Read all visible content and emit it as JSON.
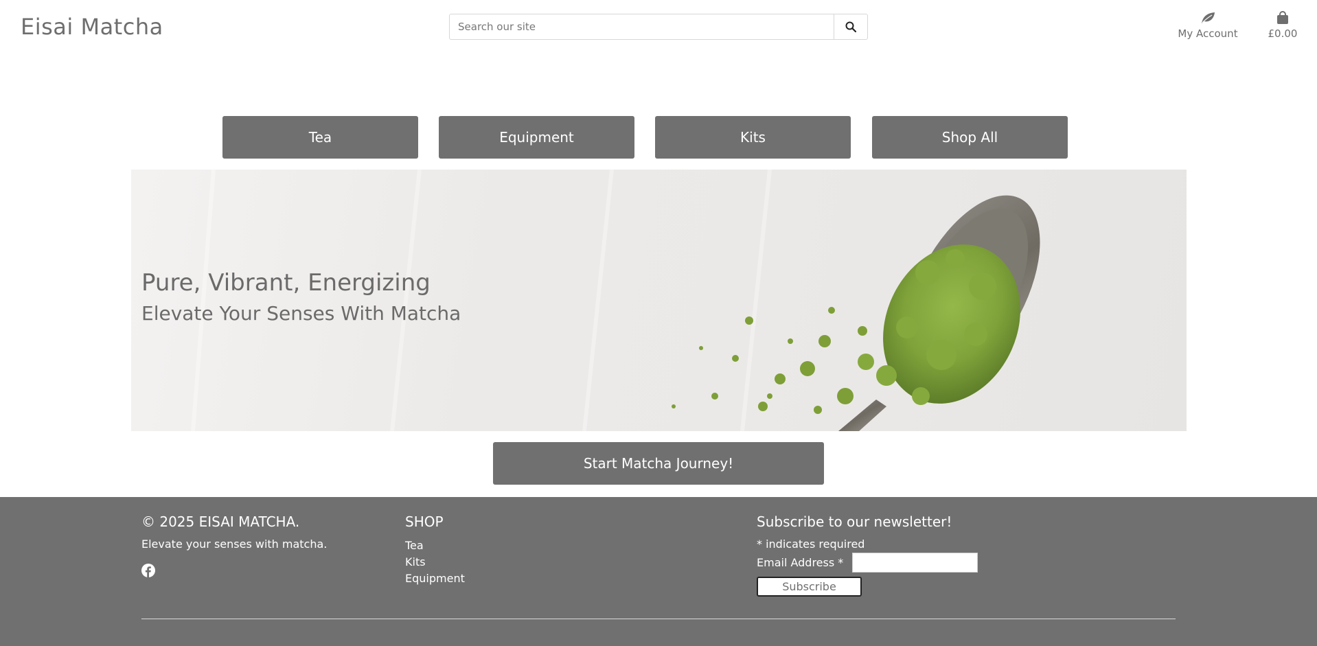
{
  "header": {
    "logo": "Eisai Matcha",
    "search": {
      "placeholder": "Search our site",
      "value": ""
    },
    "account_label": "My Account",
    "cart_total": "£0.00"
  },
  "categories": [
    {
      "label": "Tea"
    },
    {
      "label": "Equipment"
    },
    {
      "label": "Kits"
    },
    {
      "label": "Shop All"
    }
  ],
  "hero": {
    "title": "Pure, Vibrant, Energizing",
    "subtitle": "Elevate Your Senses With Matcha"
  },
  "cta_label": "Start Matcha Journey!",
  "footer": {
    "copyright": "© 2025 EISAI MATCHA.",
    "tagline": "Elevate your senses with matcha.",
    "social_icon": "facebook-icon",
    "shop_heading": "SHOP",
    "shop_links": [
      "Tea",
      "Kits",
      "Equipment"
    ],
    "newsletter_heading": "Subscribe to our newsletter!",
    "required_note": "* indicates required",
    "email_label": "Email Address *",
    "email_value": "",
    "subscribe_label": "Subscribe"
  },
  "colors": {
    "button_bg": "#707070",
    "footer_bg": "#707070",
    "text": "#6e6e6e",
    "matcha_green": "#7aa138"
  }
}
